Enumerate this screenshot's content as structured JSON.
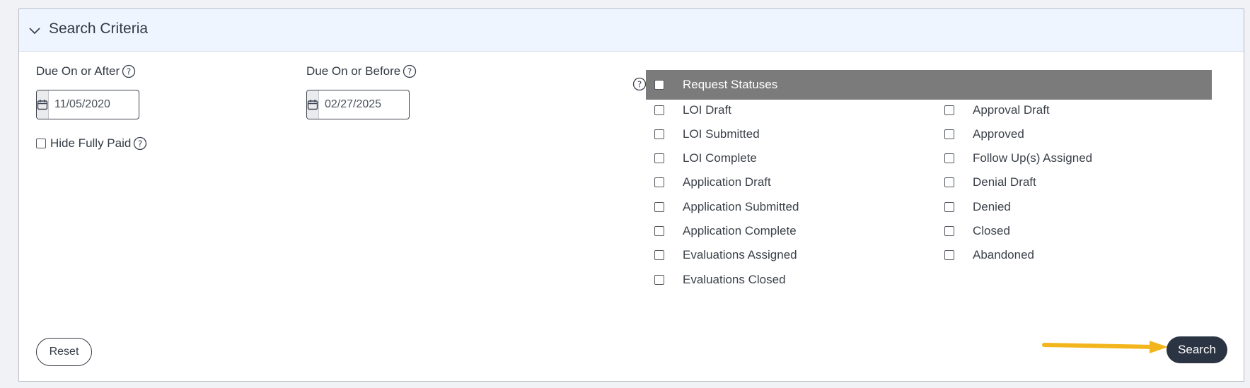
{
  "panel": {
    "title": "Search Criteria"
  },
  "filters": {
    "due_after": {
      "label": "Due On or After",
      "value": "11/05/2020"
    },
    "due_before": {
      "label": "Due On or Before",
      "value": "02/27/2025"
    },
    "hide_fully_paid": {
      "label": "Hide Fully Paid",
      "checked": false
    }
  },
  "statuses": {
    "header": "Request Statuses",
    "left": [
      "LOI Draft",
      "LOI Submitted",
      "LOI Complete",
      "Application Draft",
      "Application Submitted",
      "Application Complete",
      "Evaluations Assigned",
      "Evaluations Closed"
    ],
    "right": [
      "Approval Draft",
      "Approved",
      "Follow Up(s) Assigned",
      "Denial Draft",
      "Denied",
      "Closed",
      "Abandoned"
    ]
  },
  "buttons": {
    "reset": "Reset",
    "search": "Search"
  },
  "colors": {
    "header_bg": "#eef5fe",
    "status_header_bg": "#7b7b7b",
    "search_bg": "#2a3442",
    "arrow": "#f3b51c"
  },
  "icons": [
    "chevron-down-icon",
    "help-icon",
    "calendar-icon",
    "arrow-annotation-icon"
  ]
}
